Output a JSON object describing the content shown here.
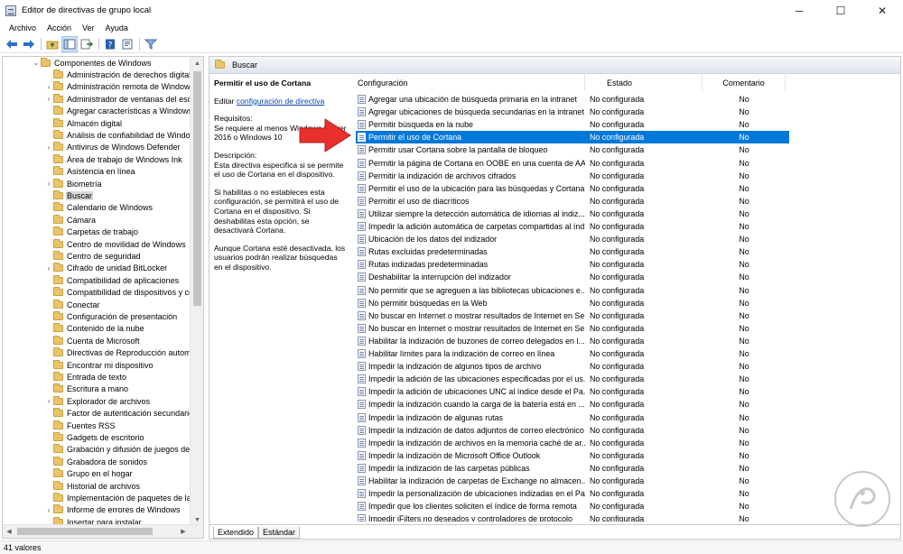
{
  "window": {
    "title": "Editor de directivas de grupo local",
    "minimize": "─",
    "maximize": "☐",
    "close": "✕"
  },
  "menu": [
    "Archivo",
    "Acción",
    "Ver",
    "Ayuda"
  ],
  "tree": {
    "root": "Componentes de Windows",
    "items": [
      {
        "label": "Administración de derechos digitale",
        "expandable": false
      },
      {
        "label": "Administración remota de Windows",
        "expandable": true
      },
      {
        "label": "Administrador de ventanas del escri",
        "expandable": true
      },
      {
        "label": "Agregar características a Windows 1",
        "expandable": false
      },
      {
        "label": "Almacén digital",
        "expandable": false
      },
      {
        "label": "Análisis de confiabilidad de Window",
        "expandable": false
      },
      {
        "label": "Antivirus de Windows Defender",
        "expandable": true
      },
      {
        "label": "Área de trabajo de Windows Ink",
        "expandable": false
      },
      {
        "label": "Asistencia en línea",
        "expandable": false
      },
      {
        "label": "Biometría",
        "expandable": true
      },
      {
        "label": "Buscar",
        "expandable": false,
        "selected": true
      },
      {
        "label": "Calendario de Windows",
        "expandable": false
      },
      {
        "label": "Cámara",
        "expandable": false
      },
      {
        "label": "Carpetas de trabajo",
        "expandable": false
      },
      {
        "label": "Centro de movilidad de Windows",
        "expandable": false
      },
      {
        "label": "Centro de seguridad",
        "expandable": false
      },
      {
        "label": "Cifrado de unidad BitLocker",
        "expandable": true
      },
      {
        "label": "Compatibilidad de aplicaciones",
        "expandable": false
      },
      {
        "label": "Compatibilidad de dispositivos y co",
        "expandable": false
      },
      {
        "label": "Conectar",
        "expandable": false
      },
      {
        "label": "Configuración de presentación",
        "expandable": false
      },
      {
        "label": "Contenido de la nube",
        "expandable": false
      },
      {
        "label": "Cuenta de Microsoft",
        "expandable": false
      },
      {
        "label": "Directivas de Reproducción automá",
        "expandable": false
      },
      {
        "label": "Encontrar mi dispositivo",
        "expandable": false
      },
      {
        "label": "Entrada de texto",
        "expandable": false
      },
      {
        "label": "Escritura a mano",
        "expandable": false
      },
      {
        "label": "Explorador de archivos",
        "expandable": true
      },
      {
        "label": "Factor de autenticación secundario",
        "expandable": false
      },
      {
        "label": "Fuentes RSS",
        "expandable": false
      },
      {
        "label": "Gadgets de escritorio",
        "expandable": false
      },
      {
        "label": "Grabación y difusión de juegos de W",
        "expandable": false
      },
      {
        "label": "Grabadora de sonidos",
        "expandable": false
      },
      {
        "label": "Grupo en el hogar",
        "expandable": false
      },
      {
        "label": "Historial de archivos",
        "expandable": false
      },
      {
        "label": "Implementación de paquetes de la a",
        "expandable": false
      },
      {
        "label": "Informe de errores de Windows",
        "expandable": true
      },
      {
        "label": "Insertar para instalar",
        "expandable": false
      }
    ]
  },
  "right": {
    "header": "Buscar",
    "description": {
      "title": "Permitir el uso de Cortana",
      "edit_prefix": "Editar",
      "edit_link": "configuración de directiva",
      "requirements_label": "Requisitos:",
      "requirements_text": "Se requiere al menos Windows Server 2016 o Windows 10",
      "description_label": "Descripción:",
      "description_text": "Esta directiva especifica si se permite el uso de Cortana en el dispositivo.",
      "para2": "Si habilitas o no estableces esta configuración, se permitirá el uso de Cortana en el dispositivo. Si deshabilitas esta opción, se desactivará Cortana.",
      "para3": "Aunque Cortana esté desactivada, los usuarios podrán realizar búsquedas en el dispositivo."
    },
    "columns": {
      "name": "Configuración",
      "state": "Estado",
      "comment": "Comentario"
    },
    "policies": [
      {
        "name": "Agregar una ubicación de búsqueda primaria en la intranet",
        "state": "No configurada",
        "comment": "No"
      },
      {
        "name": "Agregar ubicaciones de búsqueda secundarias en la intranet",
        "state": "No configurada",
        "comment": "No"
      },
      {
        "name": "Permitir búsqueda en la nube",
        "state": "No configurada",
        "comment": "No"
      },
      {
        "name": "Permitir el uso de Cortana",
        "state": "No configurada",
        "comment": "No",
        "selected": true
      },
      {
        "name": "Permitir usar Cortana sobre la pantalla de bloqueo",
        "state": "No configurada",
        "comment": "No"
      },
      {
        "name": "Permitir la página de Cortana en OOBE en una cuenta de AAD",
        "state": "No configurada",
        "comment": "No"
      },
      {
        "name": "Permitir la indización de archivos cifrados",
        "state": "No configurada",
        "comment": "No"
      },
      {
        "name": "Permitir el uso de la ubicación para las búsquedas y Cortana",
        "state": "No configurada",
        "comment": "No"
      },
      {
        "name": "Permitir el uso de diacríticos",
        "state": "No configurada",
        "comment": "No"
      },
      {
        "name": "Utilizar siempre la detección automática de idiomas al indiz...",
        "state": "No configurada",
        "comment": "No"
      },
      {
        "name": "Impedir la adición automática de carpetas compartidas al índ...",
        "state": "No configurada",
        "comment": "No"
      },
      {
        "name": "Ubicación de los datos del indizador",
        "state": "No configurada",
        "comment": "No"
      },
      {
        "name": "Rutas excluidas predeterminadas",
        "state": "No configurada",
        "comment": "No"
      },
      {
        "name": "Rutas indizadas predeterminadas",
        "state": "No configurada",
        "comment": "No"
      },
      {
        "name": "Deshabilitar la interrupción del indizador",
        "state": "No configurada",
        "comment": "No"
      },
      {
        "name": "No permitir que se agreguen a las bibliotecas ubicaciones e...",
        "state": "No configurada",
        "comment": "No"
      },
      {
        "name": "No permitir búsquedas en la Web",
        "state": "No configurada",
        "comment": "No"
      },
      {
        "name": "No buscar en Internet o mostrar resultados de Internet en Se...",
        "state": "No configurada",
        "comment": "No"
      },
      {
        "name": "No buscar en Internet o mostrar resultados de Internet en Se...",
        "state": "No configurada",
        "comment": "No"
      },
      {
        "name": "Habilitar la indización de buzones de correo delegados en l...",
        "state": "No configurada",
        "comment": "No"
      },
      {
        "name": "Habilitar límites para la indización de correo en línea",
        "state": "No configurada",
        "comment": "No"
      },
      {
        "name": "Impedir la indización de algunos tipos de archivo",
        "state": "No configurada",
        "comment": "No"
      },
      {
        "name": "Impedir la adición de las ubicaciones especificadas por el us...",
        "state": "No configurada",
        "comment": "No"
      },
      {
        "name": "Impedir la adición de ubicaciones UNC al índice desde el Pa...",
        "state": "No configurada",
        "comment": "No"
      },
      {
        "name": "Impedir la indización cuando la carga de la batería está en ...",
        "state": "No configurada",
        "comment": "No"
      },
      {
        "name": "Impedir la indización de algunas rutas",
        "state": "No configurada",
        "comment": "No"
      },
      {
        "name": "Impedir la indización de datos adjuntos de correo electrónico",
        "state": "No configurada",
        "comment": "No"
      },
      {
        "name": "Impedir la indización de archivos en la memoria caché de ar...",
        "state": "No configurada",
        "comment": "No"
      },
      {
        "name": "Impedir la indización de Microsoft Office Outlook",
        "state": "No configurada",
        "comment": "No"
      },
      {
        "name": "Impedir la indización de las carpetas públicas",
        "state": "No configurada",
        "comment": "No"
      },
      {
        "name": "Habilitar la indización de carpetas de Exchange no almacen...",
        "state": "No configurada",
        "comment": "No"
      },
      {
        "name": "Impedir la personalización de ubicaciones indizadas en el Pa...",
        "state": "No configurada",
        "comment": "No"
      },
      {
        "name": "Impedir que los clientes soliciten el índice de forma remota",
        "state": "No configurada",
        "comment": "No"
      },
      {
        "name": "Impedir iFilters no deseados y controladores de protocolo",
        "state": "No configurada",
        "comment": "No"
      }
    ],
    "tabs": [
      "Extendido",
      "Estándar"
    ]
  },
  "status": "41 valores",
  "colors": {
    "selection": "#0078d7",
    "arrow": "#e8302c",
    "folder": "#e9c46a"
  }
}
